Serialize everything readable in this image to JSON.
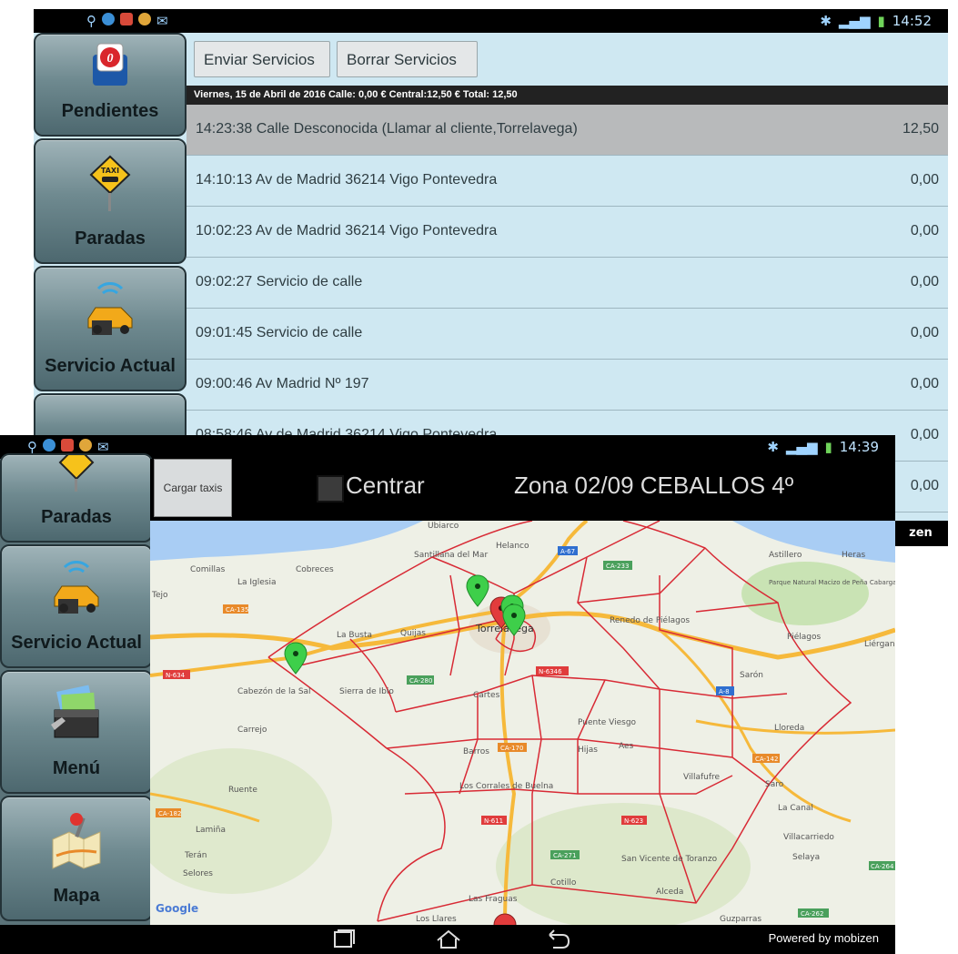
{
  "top": {
    "status_time": "14:52",
    "nav": [
      {
        "label": "Pendientes",
        "icon": "pendientes-icon"
      },
      {
        "label": "Paradas",
        "icon": "taxi-stop-icon"
      },
      {
        "label": "Servicio Actual",
        "icon": "taxi-car-icon"
      }
    ],
    "toolbar": {
      "send_label": "Enviar Servicios",
      "delete_label": "Borrar Servicios"
    },
    "info": "Viernes, 15 de Abril de 2016    Calle: 0,00 €  Central:12,50 €  Total: 12,50",
    "services": [
      {
        "text": "14:23:38  Calle Desconocida (Llamar al cliente,Torrelavega)",
        "amount": "12,50"
      },
      {
        "text": "14:10:13  Av de Madrid 36214 Vigo Pontevedra",
        "amount": "0,00"
      },
      {
        "text": "10:02:23  Av de Madrid 36214 Vigo Pontevedra",
        "amount": "0,00"
      },
      {
        "text": "09:02:27  Servicio de calle",
        "amount": "0,00"
      },
      {
        "text": "09:01:45  Servicio de calle",
        "amount": "0,00"
      },
      {
        "text": "09:00:46  Av Madrid Nº 197",
        "amount": "0,00"
      },
      {
        "text": "08:58:46  Av de Madrid 36214 Vigo Pontevedra",
        "amount": "0,00"
      },
      {
        "text": "",
        "amount": "0,00"
      }
    ]
  },
  "bottom": {
    "status_time": "14:39",
    "nav": [
      {
        "label": "Paradas",
        "icon": "taxi-stop-icon"
      },
      {
        "label": "Servicio Actual",
        "icon": "taxi-car-icon"
      },
      {
        "label": "Menú",
        "icon": "menu-toolbox-icon"
      },
      {
        "label": "Mapa",
        "icon": "map-pin-icon"
      }
    ],
    "cargar_label": "Cargar taxis",
    "centrar_label": "Centrar",
    "zona_label": "Zona 02/09 CEBALLOS 4º",
    "powered": "Powered by mobizen",
    "map_labels": [
      "Ubiarco",
      "Santillana del Mar",
      "Helanco",
      "Comillas",
      "La Iglesia",
      "Cobreces",
      "Tejo",
      "La Busta",
      "Quijas",
      "Torrelavega",
      "Renedo de Piélagos",
      "Astillero",
      "Heras",
      "Parque Natural Macizo de Peña Cabarga",
      "Piélagos",
      "Liérganes",
      "Cabezón de la Sal",
      "Sierra de Ibio",
      "Carrejo",
      "Cartes",
      "Sarón",
      "Puente Viesgo",
      "Lloreda",
      "Barros",
      "Hijas",
      "Aes",
      "Villafufre",
      "Saro",
      "La Canal",
      "Ruente",
      "Los Corrales de Buelna",
      "Lamiña",
      "Villacarriedo",
      "Terán",
      "Selores",
      "Selaya",
      "San Vicente de Toranzo",
      "Cotillo",
      "Alceda",
      "Las Fraguas",
      "Los Llares",
      "Guzparras",
      "Google"
    ],
    "road_labels": [
      "CA-135",
      "N-634",
      "CA-233",
      "A-67",
      "CA-280",
      "N-6346",
      "A-8",
      "CA-170",
      "CA-142",
      "CA-182",
      "N-611",
      "N-623",
      "CA-271",
      "CA-264",
      "CA-262"
    ]
  },
  "colors": {
    "zone_lines": "#d82a35",
    "list_bg": "#cfe8f2",
    "selected_row": "#b8babb",
    "marker_green": "#3ecf4a",
    "marker_red": "#e23c3c"
  }
}
